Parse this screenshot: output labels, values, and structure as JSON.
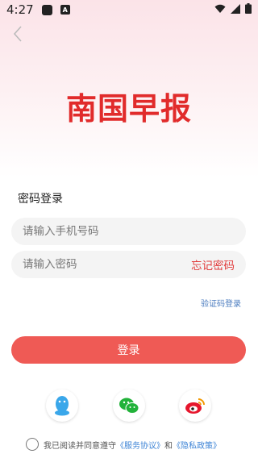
{
  "status_bar": {
    "time": "4:27",
    "notif_letter": "A"
  },
  "logo": {
    "text": "南国早报"
  },
  "login": {
    "title": "密码登录",
    "phone_placeholder": "请输入手机号码",
    "password_placeholder": "请输入密码",
    "forgot_label": "忘记密码",
    "sms_login_label": "验证码登录",
    "submit_label": "登录"
  },
  "social": {
    "icons": [
      "qq-icon",
      "wechat-icon",
      "weibo-icon"
    ]
  },
  "agreement": {
    "prefix": "我已阅读并同意遵守",
    "service_link": "《服务协议》",
    "and": "和",
    "privacy_link": "《隐私政策》"
  },
  "colors": {
    "brand_red": "#e12b2b",
    "button_red": "#ef5a55",
    "link_blue": "#3e84d6"
  }
}
